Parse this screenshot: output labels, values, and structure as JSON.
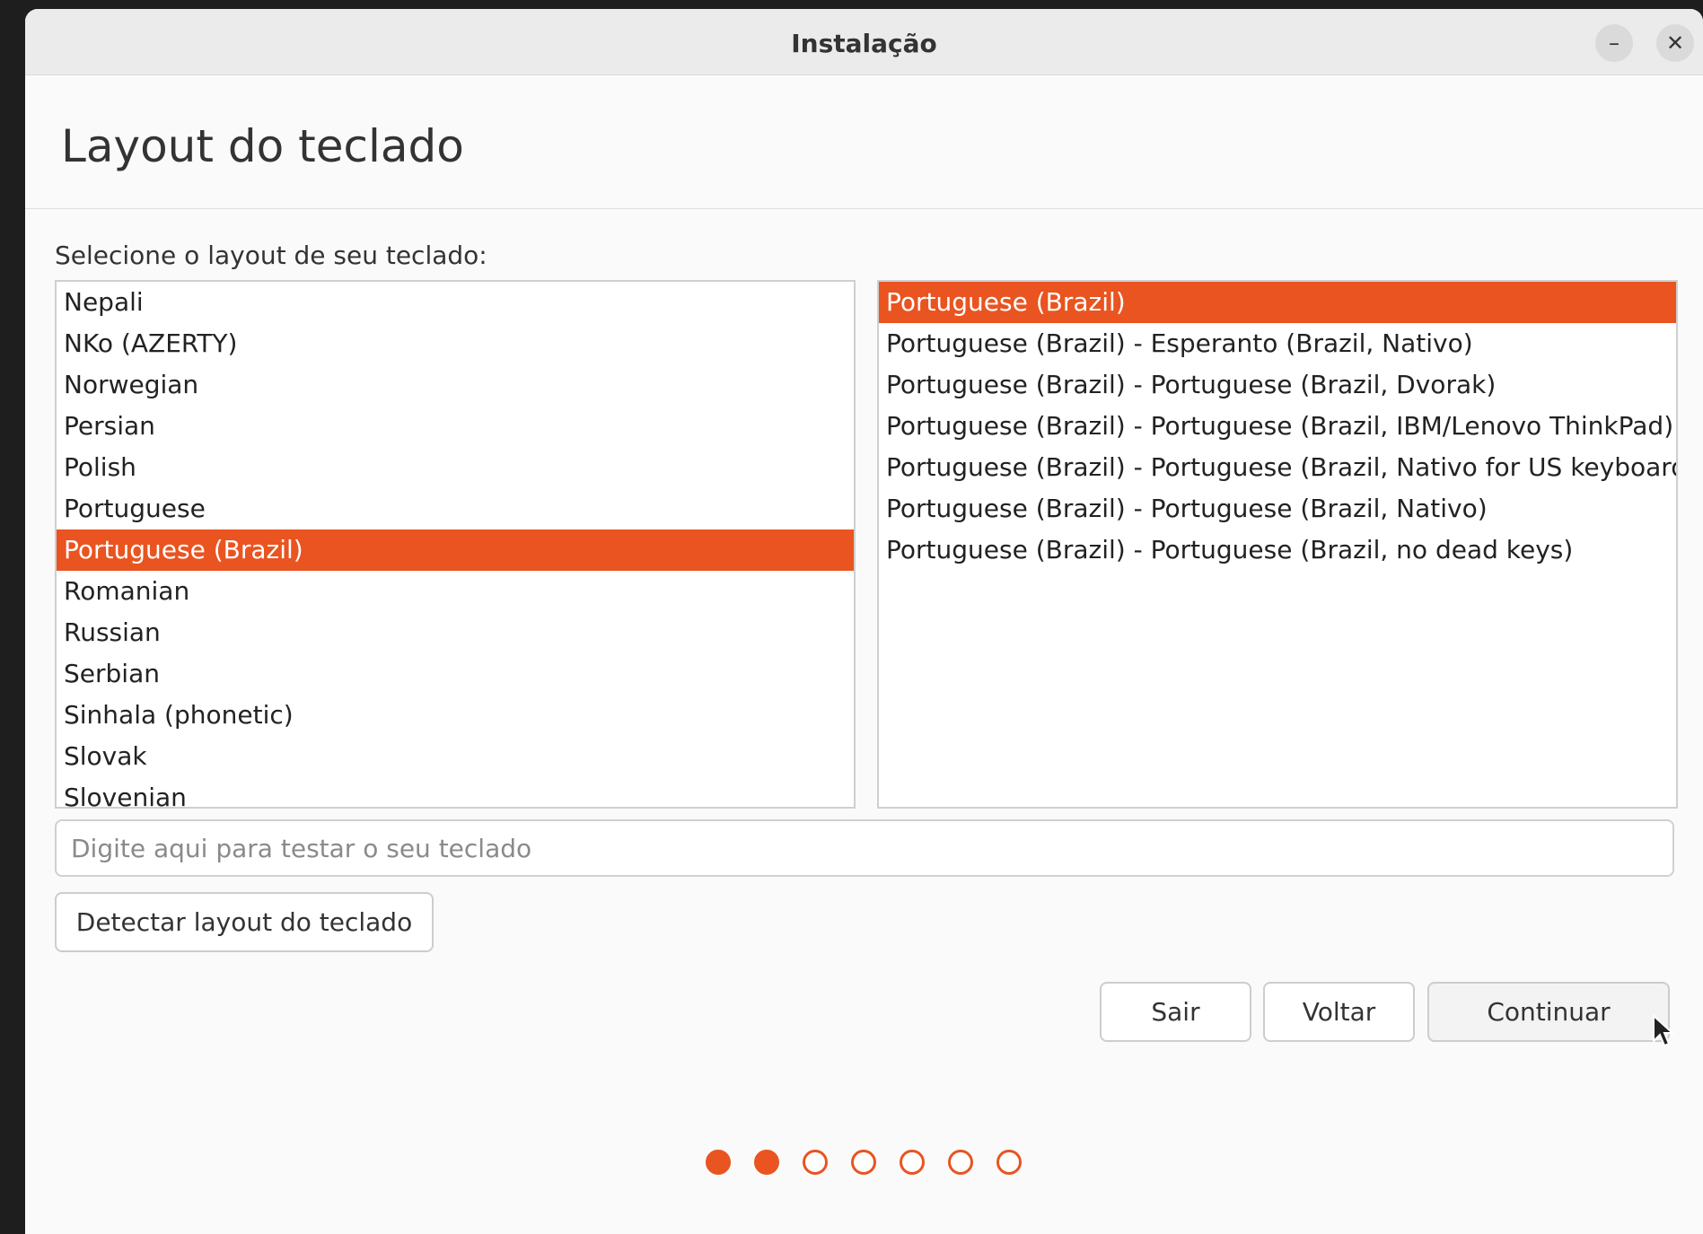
{
  "window": {
    "title": "Instalação",
    "minimize_glyph": "–",
    "close_glyph": "✕"
  },
  "page": {
    "title": "Layout do teclado",
    "prompt": "Selecione o layout de seu teclado:"
  },
  "layouts": [
    {
      "label": "Nepali",
      "selected": false
    },
    {
      "label": "NKo (AZERTY)",
      "selected": false
    },
    {
      "label": "Norwegian",
      "selected": false
    },
    {
      "label": "Persian",
      "selected": false
    },
    {
      "label": "Polish",
      "selected": false
    },
    {
      "label": "Portuguese",
      "selected": false
    },
    {
      "label": "Portuguese (Brazil)",
      "selected": true
    },
    {
      "label": "Romanian",
      "selected": false
    },
    {
      "label": "Russian",
      "selected": false
    },
    {
      "label": "Serbian",
      "selected": false
    },
    {
      "label": "Sinhala (phonetic)",
      "selected": false
    },
    {
      "label": "Slovak",
      "selected": false
    },
    {
      "label": "Slovenian",
      "selected": false
    }
  ],
  "variants": [
    {
      "label": "Portuguese (Brazil)",
      "selected": true
    },
    {
      "label": "Portuguese (Brazil) - Esperanto (Brazil, Nativo)",
      "selected": false
    },
    {
      "label": "Portuguese (Brazil) - Portuguese (Brazil, Dvorak)",
      "selected": false
    },
    {
      "label": "Portuguese (Brazil) - Portuguese (Brazil, IBM/Lenovo ThinkPad)",
      "selected": false
    },
    {
      "label": "Portuguese (Brazil) - Portuguese (Brazil, Nativo for US keyboards)",
      "selected": false
    },
    {
      "label": "Portuguese (Brazil) - Portuguese (Brazil, Nativo)",
      "selected": false
    },
    {
      "label": "Portuguese (Brazil) - Portuguese (Brazil, no dead keys)",
      "selected": false
    }
  ],
  "test_input": {
    "value": "",
    "placeholder": "Digite aqui para testar o seu teclado"
  },
  "buttons": {
    "detect": "Detectar layout do teclado",
    "quit": "Sair",
    "back": "Voltar",
    "continue": "Continuar"
  },
  "progress": {
    "total_steps": 7,
    "completed_steps": 2
  },
  "colors": {
    "accent": "#e95420"
  }
}
